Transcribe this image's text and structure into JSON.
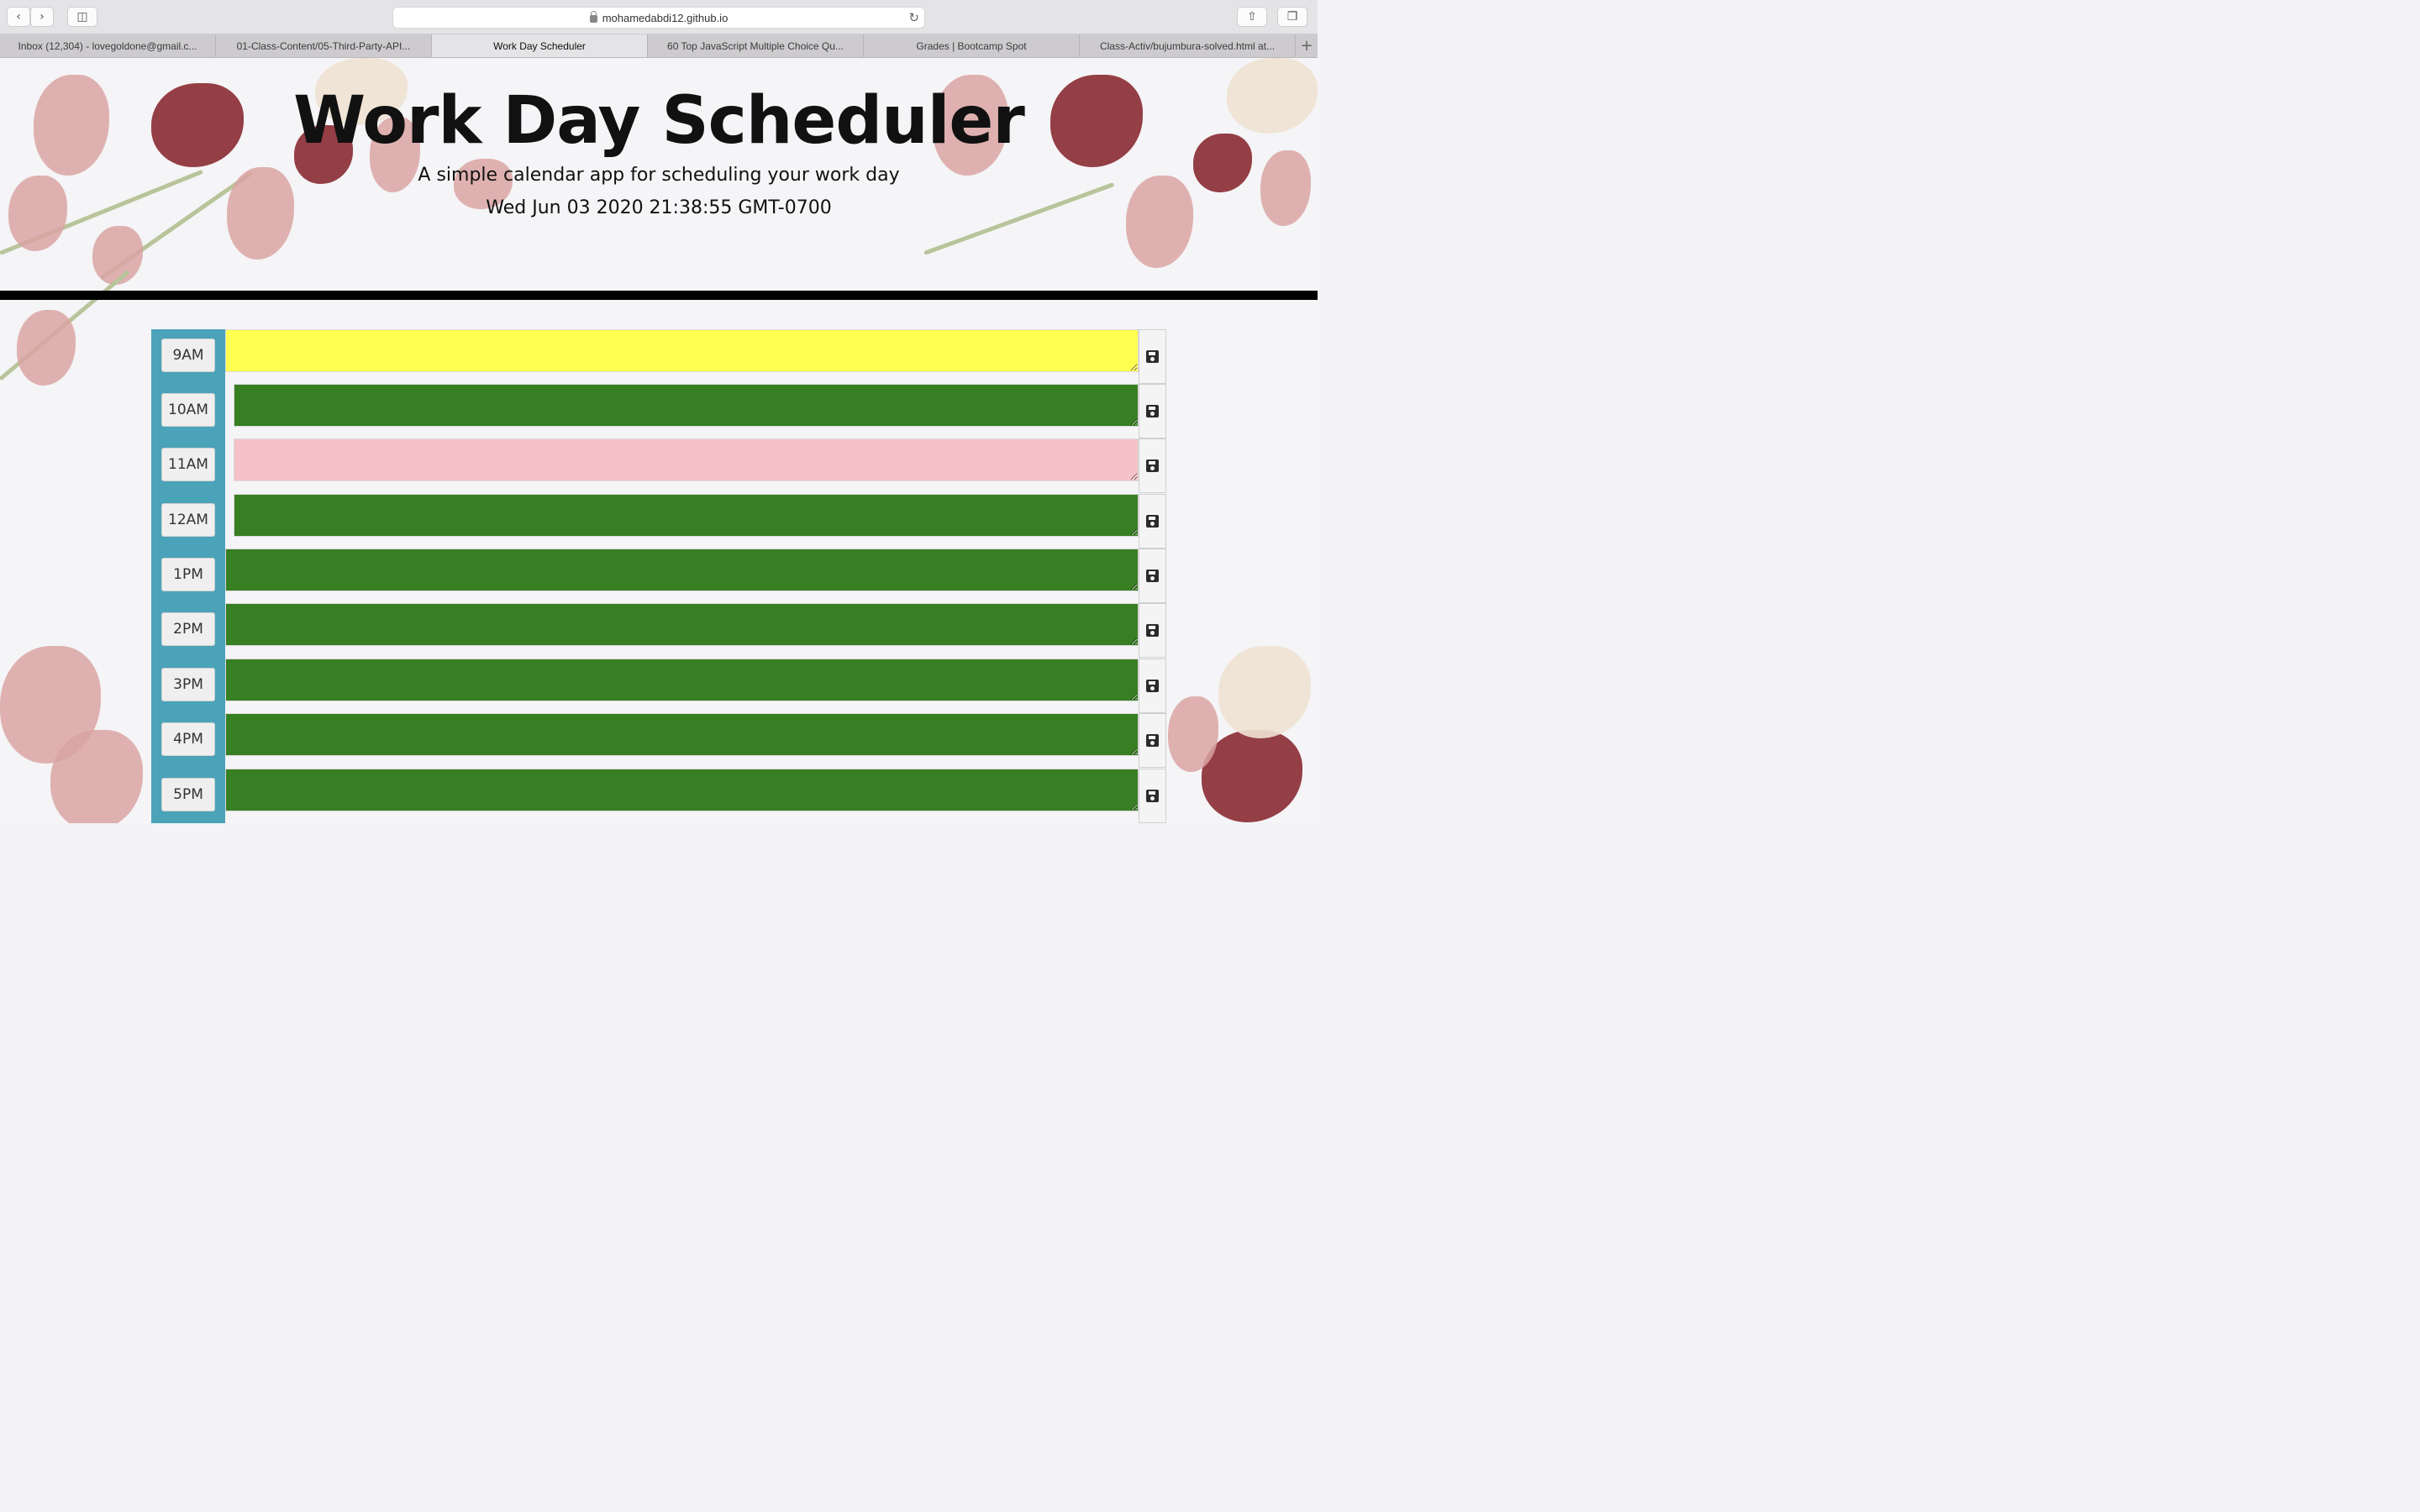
{
  "browser": {
    "url": "mohamedabdi12.github.io",
    "tabs": [
      {
        "label": "Inbox (12,304) - lovegoldone@gmail.c..."
      },
      {
        "label": "01-Class-Content/05-Third-Party-API..."
      },
      {
        "label": "Work Day Scheduler"
      },
      {
        "label": "60 Top JavaScript Multiple Choice Qu..."
      },
      {
        "label": "Grades | Bootcamp Spot"
      },
      {
        "label": "Class-Activ/bujumbura-solved.html at..."
      }
    ],
    "active_tab": 2
  },
  "header": {
    "title": "Work Day Scheduler",
    "lead": "A simple calendar app for scheduling your work day",
    "current_day": "Wed Jun 03 2020 21:38:55 GMT-0700"
  },
  "rows": [
    {
      "hour": "9AM",
      "state": "present",
      "text": ""
    },
    {
      "hour": "10AM",
      "state": "future",
      "text": ""
    },
    {
      "hour": "11AM",
      "state": "past",
      "text": ""
    },
    {
      "hour": "12AM",
      "state": "future",
      "text": ""
    },
    {
      "hour": "1PM",
      "state": "future",
      "text": ""
    },
    {
      "hour": "2PM",
      "state": "future",
      "text": ""
    },
    {
      "hour": "3PM",
      "state": "future",
      "text": ""
    },
    {
      "hour": "4PM",
      "state": "future",
      "text": ""
    },
    {
      "hour": "5PM",
      "state": "future",
      "text": ""
    }
  ],
  "colors": {
    "present": "#ffff4f",
    "future": "#377f22",
    "past": "#f6c1c8",
    "hour_column": "#4aa3b8"
  },
  "icons": {
    "back": "chevron-left-icon",
    "forward": "chevron-right-icon",
    "sidebar": "sidebar-icon",
    "lock": "lock-icon",
    "reload": "reload-icon",
    "share": "share-icon",
    "tabs_overview": "tabs-icon",
    "save": "floppy-disk-icon"
  }
}
